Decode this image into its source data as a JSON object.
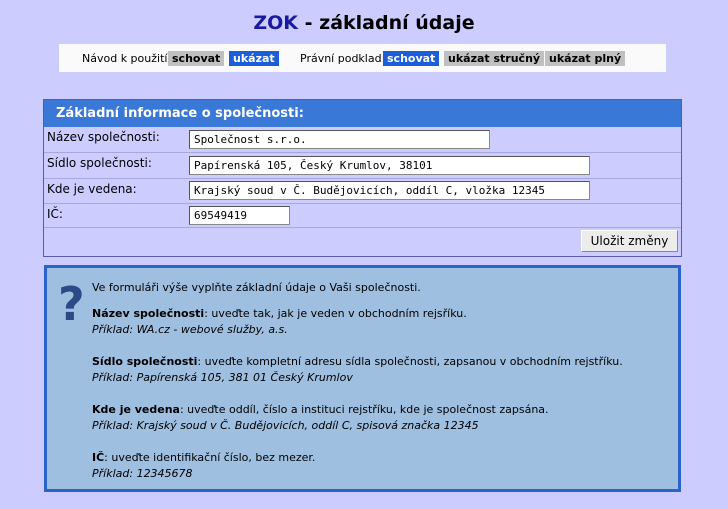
{
  "title": {
    "brand": "ZOK",
    "rest": " - základní údaje"
  },
  "toolbar": {
    "guide_label": "Návod k použití:",
    "guide_hide": "schovat",
    "guide_show": "ukázat",
    "legal_label": "Právní podklad:",
    "legal_hide": "schovat",
    "legal_brief": "ukázat stručný",
    "legal_full": "ukázat plný"
  },
  "form": {
    "header": "Základní informace o společnosti:",
    "rows": [
      {
        "label": "Název společnosti:",
        "value": "Společnost s.r.o."
      },
      {
        "label": "Sídlo společnosti:",
        "value": "Papírenská 105, Český Krumlov, 38101"
      },
      {
        "label": "Kde je vedena:",
        "value": "Krajský soud v Č. Budějovicích, oddíl C, vložka 12345"
      },
      {
        "label": "IČ:",
        "value": "69549419"
      }
    ],
    "save_label": "Uložit změny"
  },
  "help": {
    "icon": "question-mark-icon",
    "intro": "Ve formuláři výše vyplňte základní údaje o Vaši společnosti.",
    "items": [
      {
        "term": "Název společnosti",
        "desc": ": uveďte tak, jak je veden v obchodním rejsříku.",
        "example": "Příklad: WA.cz - webové služby, a.s."
      },
      {
        "term": "Sídlo společnosti",
        "desc": ": uveďte kompletní adresu sídla společnosti, zapsanou v obchodním rejstříku.",
        "example": "Příklad: Papírenská 105, 381 01 Český Krumlov"
      },
      {
        "term": "Kde je vedena",
        "desc": ": uveďte oddíl, číslo a instituci rejstříku, kde je společnost zapsána.",
        "example": "Příklad: Krajský soud v Č. Budějovicích, oddíl C, spisová značka 12345"
      },
      {
        "term": "IČ",
        "desc": ": uveďte identifikační číslo, bez mezer.",
        "example": "Příklad: 12345678"
      }
    ]
  },
  "colors": {
    "background": "#ccccff",
    "accent": "#1c5ed8",
    "header": "#3a78d8",
    "help_bg": "#9fbfe0"
  }
}
